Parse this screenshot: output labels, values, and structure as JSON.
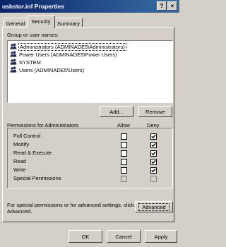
{
  "window": {
    "title": "usbstor.inf Properties",
    "help_label": "?",
    "close_label": "×"
  },
  "tabs": [
    {
      "label": "General"
    },
    {
      "label": "Security"
    },
    {
      "label": "Summary"
    }
  ],
  "security": {
    "group_label": "Group or user names:",
    "users": [
      {
        "name": "Administrators (ADMINADE5\\Administrators)"
      },
      {
        "name": "Power Users (ADMINADE5\\Power Users)"
      },
      {
        "name": "SYSTEM"
      },
      {
        "name": "Users (ADMINADE5\\Users)"
      }
    ],
    "add_label": "Add...",
    "remove_label": "Remove",
    "permissions_header": "Permissions for Administrators",
    "allow_header": "Allow",
    "deny_header": "Deny",
    "permissions": [
      {
        "name": "Full Control",
        "allow": false,
        "deny": true
      },
      {
        "name": "Modify",
        "allow": false,
        "deny": true
      },
      {
        "name": "Read & Execute",
        "allow": false,
        "deny": true
      },
      {
        "name": "Read",
        "allow": false,
        "deny": true
      },
      {
        "name": "Write",
        "allow": false,
        "deny": true
      },
      {
        "name": "Special Permissions",
        "allow": false,
        "deny": false
      }
    ],
    "advanced_note": "For special permissions or for advanced settings, click Advanced.",
    "advanced_label": "Advanced"
  },
  "footer": {
    "ok_label": "OK",
    "cancel_label": "Cancel",
    "apply_label": "Apply"
  }
}
